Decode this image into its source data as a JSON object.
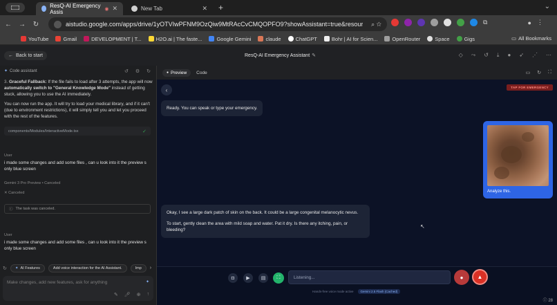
{
  "browser": {
    "tabs": [
      {
        "title": "ResQ-AI Emergency Assis",
        "active": true
      },
      {
        "title": "New Tab",
        "active": false
      }
    ],
    "url": "aistudio.google.com/apps/drive/1yOTVIwPFNM9OzQiw9MtRAcCvCMQOPFO9?showAssistant=true&resourceKey=...",
    "bookmarks": [
      "YouTube",
      "Gmail",
      "DEVELOPMENT | T...",
      "H2O.ai | The faste...",
      "Google Gemini",
      "claude",
      "ChatGPT",
      "Bohr | AI for Scien...",
      "OpenRouter",
      "Space",
      "Gigs"
    ],
    "all_bookmarks": "All Bookmarks",
    "extension_colors": [
      "#e53935",
      "#8e24aa",
      "#5e35b1",
      "#9e9e9e",
      "#e0e0e0",
      "#43a047",
      "#1e88e5",
      "#bdbdbd"
    ]
  },
  "app": {
    "back_label": "Back to start",
    "title": "ResQ-AI Emergency Assistant"
  },
  "assistant": {
    "header": "Code assistant",
    "point3_title": "Graceful Fallback:",
    "point3_text": "If the file fails to load after 3 attempts, the app will now",
    "point3_bold": "automatically switch to \"General Knowledge Mode\"",
    "point3_tail": "instead of getting stuck, allowing you to use the AI immediately.",
    "summary": "You can now run the app. It will try to load your medical library, and if it can't (due to environment restrictions), it will simply tell you and let you proceed with the rest of the features.",
    "file": "components/Modules/InteractiveMode.tsx",
    "user_label_1": "User",
    "user_msg_1": "i made some changes and add some files , can u look into it the preview s only blue screen",
    "model_label": "Gemini 3 Pro Preview",
    "model_status": "Canceled",
    "canceled_label": "Canceled",
    "task_canceled": "The task was canceled.",
    "user_label_2": "User",
    "user_msg_2": "i made some changes and add some files , can u look into it the preview s only blue screen",
    "chips": [
      "AI Features",
      "Add voice interaction for the AI Assistant.",
      "Imp"
    ],
    "input_placeholder": "Make changes, add new features, ask for anything"
  },
  "preview": {
    "tabs": [
      "Preview",
      "Code"
    ],
    "emergency_label": "TAP FOR EMERGENCY",
    "ai_greeting": "Ready. You can speak or type your emergency.",
    "user_caption": "Analyze this.",
    "ai_reply_1": "Okay, I see a large dark patch of skin on the back. It could be a large congenital melanocytic nevus.",
    "ai_reply_2": "To start, gently clean the area with mild soap and water. Pat it dry. Is there any itching, pain, or bleeding?",
    "listen_placeholder": "Listening...",
    "handsfree_note": "Hands-free voice mode active",
    "model_badge": "Gemini 2.5 Flash (Cached)",
    "footer_count": "28"
  }
}
